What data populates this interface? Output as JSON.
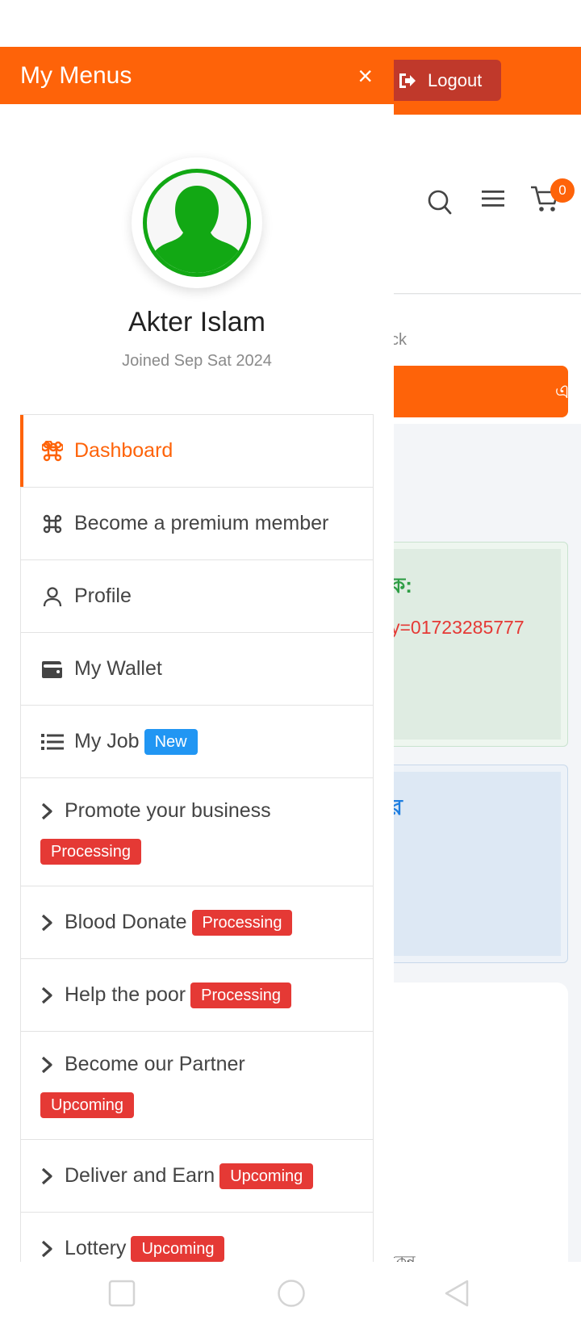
{
  "background": {
    "logout_label": "Logout",
    "cart_count": "0",
    "breadcrumb_fragment": "ck",
    "orange_bar_glyph": "এ",
    "green_box_title_fragment": "ক:",
    "green_box_link_fragment": "y=01723285777",
    "blue_box_title_fragment": "র",
    "card_text_fragment": "কেন"
  },
  "drawer": {
    "title": "My Menus",
    "close_glyph": "×",
    "user_name": "Akter Islam",
    "joined": "Joined Sep Sat 2024"
  },
  "menu": {
    "dashboard": "Dashboard",
    "premium": "Become a premium member",
    "profile": "Profile",
    "wallet": "My Wallet",
    "job": "My Job",
    "job_badge": "New",
    "promote": "Promote your business",
    "promote_badge": "Processing",
    "blood": "Blood Donate",
    "blood_badge": "Processing",
    "help": "Help the poor",
    "help_badge": "Processing",
    "partner": "Become our Partner",
    "partner_badge": "Upcoming",
    "deliver": "Deliver and Earn",
    "deliver_badge": "Upcoming",
    "lottery": "Lottery",
    "lottery_badge": "Upcoming"
  },
  "icons": {
    "logout": "logout-icon",
    "search": "search-icon",
    "hamburger": "hamburger-icon",
    "cart": "cart-icon",
    "close": "close-icon",
    "avatar": "user-silhouette-icon",
    "command": "command-icon",
    "person": "person-icon",
    "wallet": "wallet-icon",
    "list": "list-icon",
    "chevron": "chevron-right-icon",
    "nav_recent": "square-icon",
    "nav_home": "circle-icon",
    "nav_back": "triangle-back-icon"
  },
  "colors": {
    "brand_orange": "#fe6309",
    "logout_red": "#c0392b",
    "badge_red": "#e53935",
    "badge_blue": "#2196f3",
    "avatar_green": "#12a814"
  }
}
